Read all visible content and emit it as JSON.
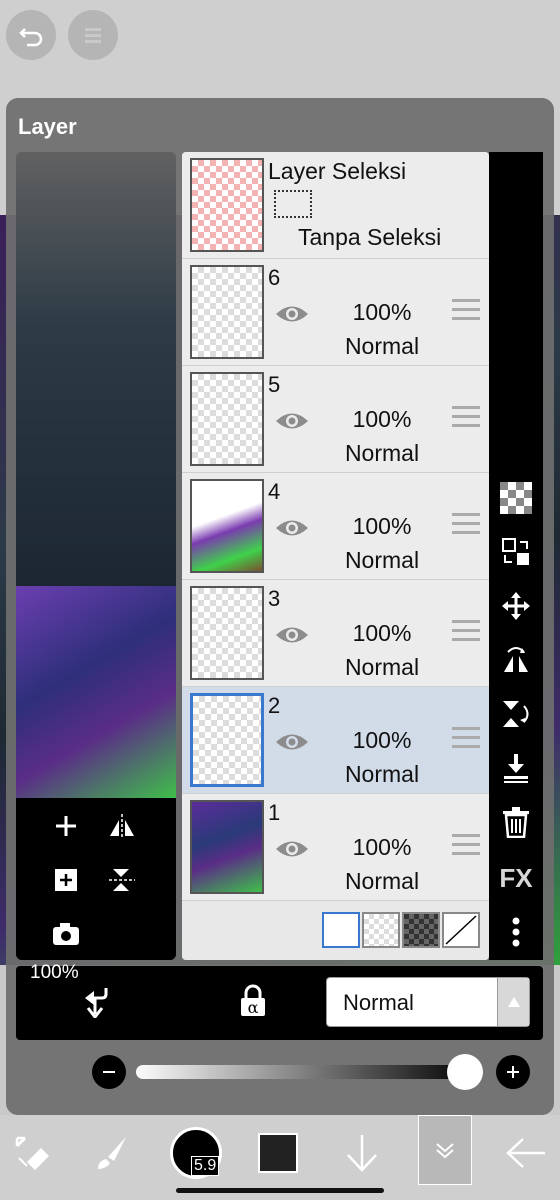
{
  "panel": {
    "title": "Layer"
  },
  "selection_layer": {
    "title": "Layer Seleksi",
    "subtitle": "Tanpa Seleksi"
  },
  "layers": [
    {
      "number": "6",
      "opacity": "100%",
      "blend": "Normal"
    },
    {
      "number": "5",
      "opacity": "100%",
      "blend": "Normal"
    },
    {
      "number": "4",
      "opacity": "100%",
      "blend": "Normal"
    },
    {
      "number": "3",
      "opacity": "100%",
      "blend": "Normal"
    },
    {
      "number": "2",
      "opacity": "100%",
      "blend": "Normal",
      "selected": true
    },
    {
      "number": "1",
      "opacity": "100%",
      "blend": "Normal"
    }
  ],
  "right_toolbar": {
    "fx_label": "FX"
  },
  "blend_mode": {
    "value": "Normal"
  },
  "opacity_slider": {
    "label": "100%",
    "value": 1.0
  },
  "brush": {
    "size": "5.9"
  },
  "colors": {
    "selected_highlight": "#d2dbe8",
    "accent": "#3a78d0",
    "current_color": "#222222"
  }
}
